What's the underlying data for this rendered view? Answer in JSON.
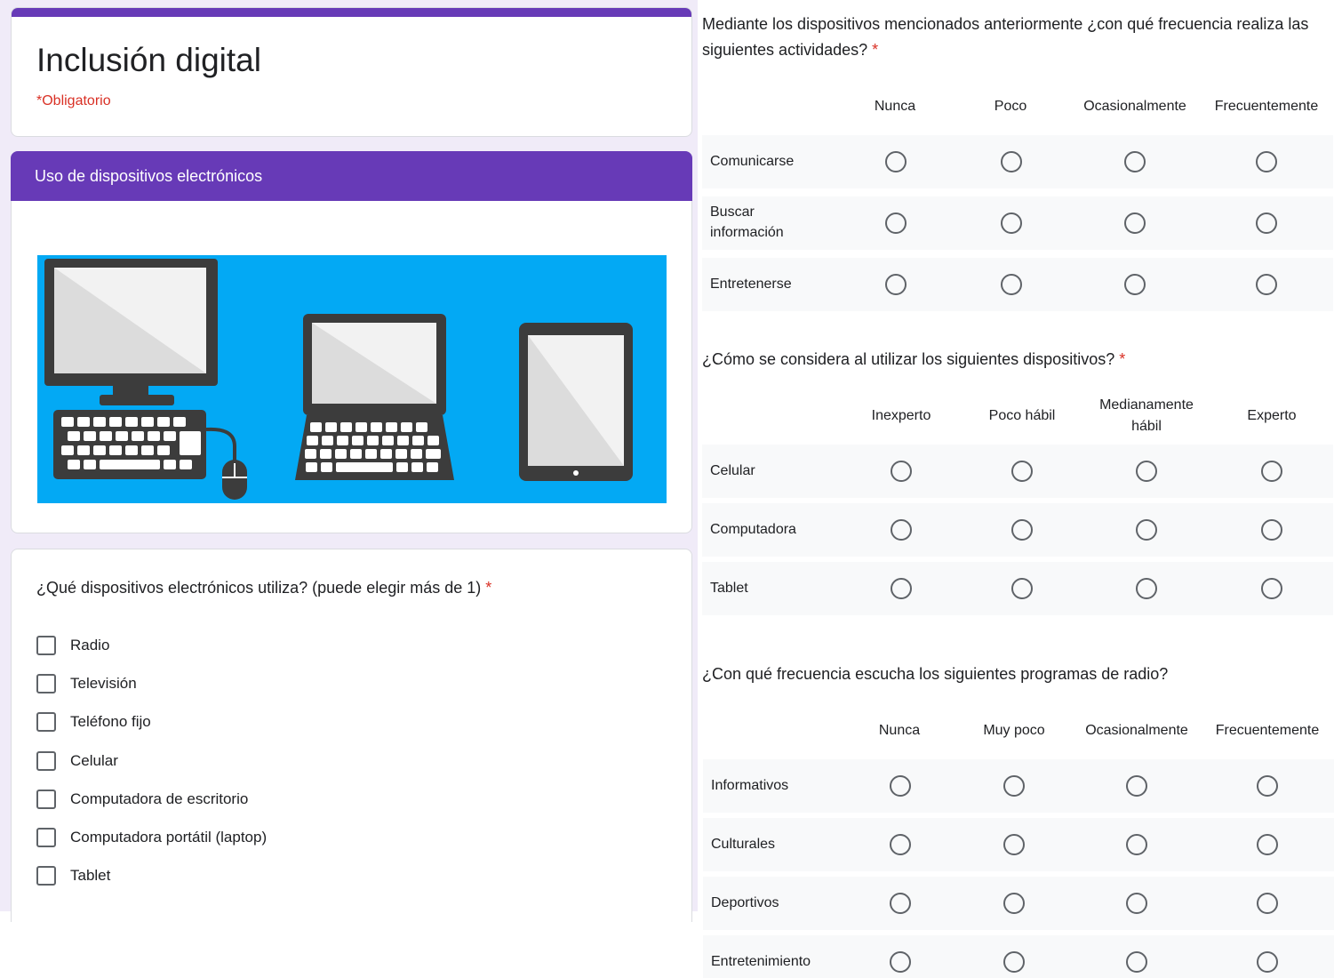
{
  "form": {
    "title": "Inclusión digital",
    "required_note": "*Obligatorio",
    "accent_color": "#673ab7",
    "required_color": "#d93025"
  },
  "section": {
    "title": "Uso de dispositivos electrónicos",
    "image_icons": [
      "desktop-computer-icon",
      "laptop-icon",
      "tablet-icon"
    ]
  },
  "q_devices": {
    "title": "¿Qué dispositivos electrónicos utiliza? (puede elegir más de 1)",
    "required_mark": "*",
    "options": [
      "Radio",
      "Televisión",
      "Teléfono fijo",
      "Celular",
      "Computadora de escritorio",
      "Computadora portátil (laptop)",
      "Tablet"
    ]
  },
  "q_frequency": {
    "title": "Mediante los dispositivos mencionados anteriormente ¿con qué frecuencia realiza las siguientes actividades?",
    "required_mark": "*",
    "columns": [
      "Nunca",
      "Poco",
      "Ocasionalmente",
      "Frecuentemente"
    ],
    "rows": [
      "Comunicarse",
      "Buscar información",
      "Entretenerse"
    ]
  },
  "q_skill": {
    "title": "¿Cómo se considera al utilizar los siguientes dispositivos?",
    "required_mark": "*",
    "columns": [
      "Inexperto",
      "Poco hábil",
      "Medianamente hábil",
      "Experto"
    ],
    "rows": [
      "Celular",
      "Computadora",
      "Tablet"
    ]
  },
  "q_radio": {
    "title": "¿Con qué frecuencia escucha los siguientes programas de radio?",
    "columns": [
      "Nunca",
      "Muy poco",
      "Ocasionalmente",
      "Frecuentemente"
    ],
    "rows": [
      "Informativos",
      "Culturales",
      "Deportivos",
      "Entretenimiento"
    ]
  }
}
